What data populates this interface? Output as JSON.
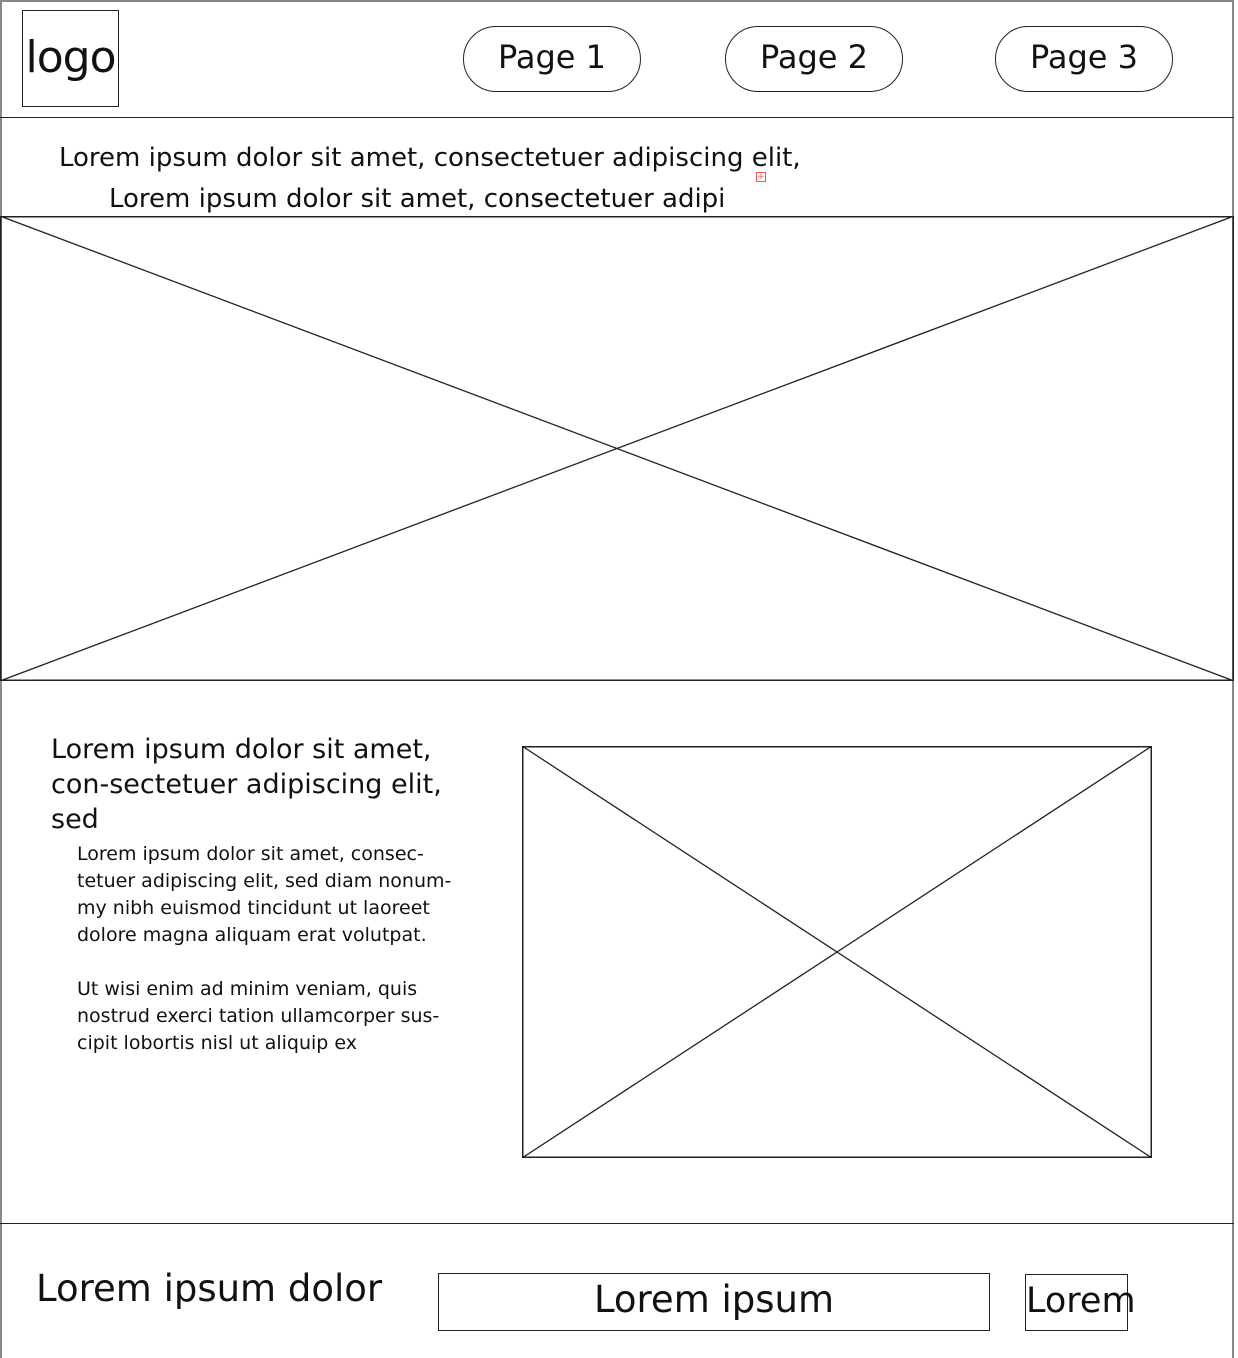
{
  "header": {
    "logo_text": "logo",
    "nav": [
      {
        "label": "Page 1"
      },
      {
        "label": "Page 2"
      },
      {
        "label": "Page 3"
      }
    ]
  },
  "intro": {
    "line1": "Lorem ipsum dolor sit amet, consectetuer adipiscing elit,",
    "line2": "Lorem ipsum dolor sit amet, consectetuer adipi"
  },
  "content": {
    "heading": "Lorem ipsum dolor sit amet, con-sectetuer adipiscing elit, sed",
    "paragraph1": "Lorem ipsum dolor sit amet, consec-tetuer adipiscing elit, sed diam nonum-my nibh euismod tincidunt ut laoreet dolore magna aliquam erat volutpat.",
    "paragraph2": "Ut wisi enim ad minim veniam, quis nostrud exerci tation ullamcorper sus-cipit lobortis nisl ut aliquip ex"
  },
  "footer": {
    "text": "Lorem ipsum dolor",
    "input_value": "Lorem ipsum",
    "button_label": "Lorem"
  }
}
